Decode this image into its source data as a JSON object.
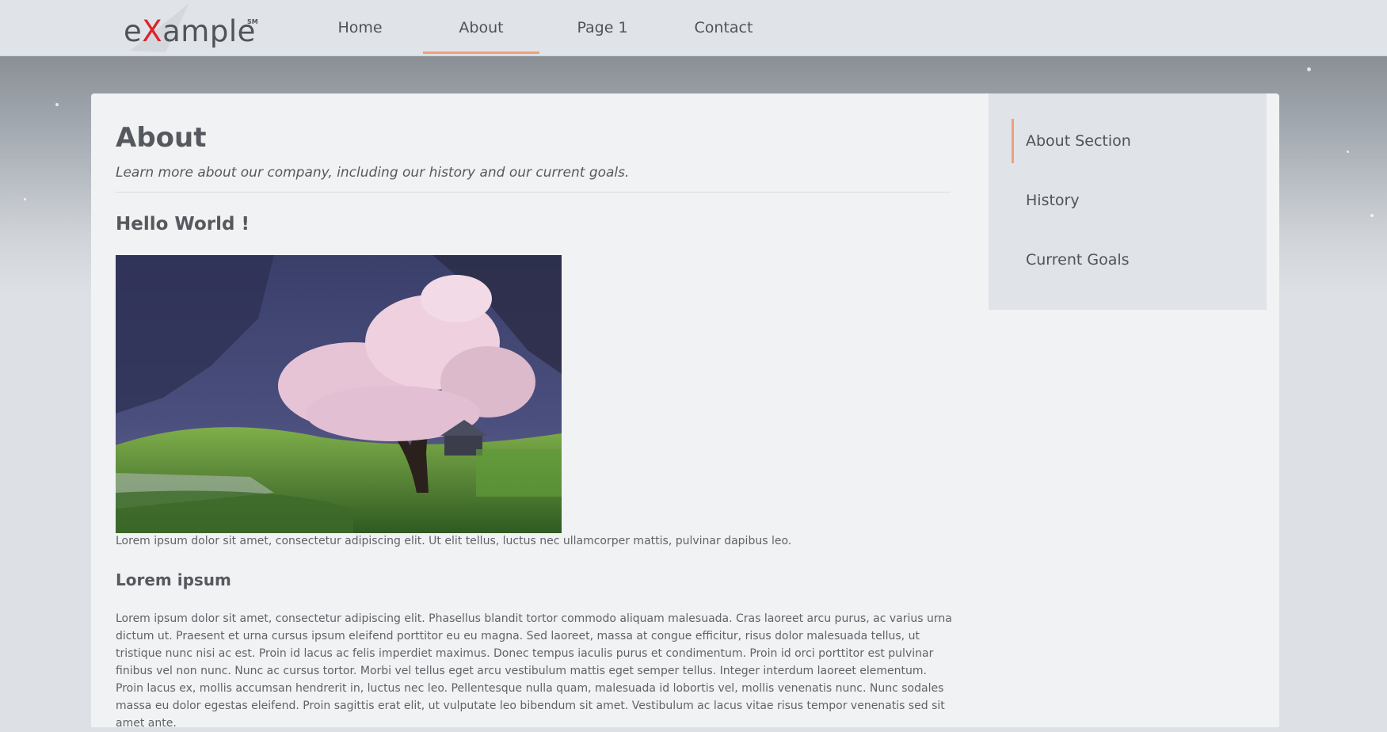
{
  "brand": {
    "logo_prefix": "e",
    "logo_x": "X",
    "logo_suffix": "ample",
    "logo_mark": "SM",
    "accent_color": "#f0a07a",
    "logo_x_color": "#d9252b"
  },
  "nav": {
    "items": [
      {
        "label": "Home"
      },
      {
        "label": "About",
        "active": true
      },
      {
        "label": "Page 1"
      },
      {
        "label": "Contact"
      }
    ]
  },
  "main": {
    "title": "About",
    "subtitle": "Learn more about our company, including our history and our current goals.",
    "section_heading": "Hello World !",
    "image_caption": "Lorem ipsum dolor sit amet, consectetur adipiscing elit. Ut elit tellus, luctus nec ullamcorper mattis, pulvinar dapibus leo.",
    "sub_heading": "Lorem ipsum",
    "paragraph": "Lorem ipsum dolor sit amet, consectetur adipiscing elit. Phasellus blandit tortor commodo aliquam malesuada. Cras laoreet arcu purus, ac varius urna dictum ut. Praesent et urna cursus ipsum eleifend porttitor eu eu magna. Sed laoreet, massa at congue efficitur, risus dolor malesuada tellus, ut tristique nunc nisi ac est. Proin id lacus ac felis imperdiet maximus. Donec tempus iaculis purus et condimentum. Proin id orci porttitor est pulvinar finibus vel non nunc. Nunc ac cursus tortor. Morbi vel tellus eget arcu vestibulum mattis eget semper tellus. Integer interdum laoreet elementum. Proin lacus ex, mollis accumsan hendrerit in, luctus nec leo. Pellentesque nulla quam, malesuada id lobortis vel, mollis venenatis nunc. Nunc sodales massa eu dolor egestas eleifend. Proin sagittis erat elit, ut vulputate leo bibendum sit amet. Vestibulum ac lacus vitae risus tempor venenatis sed sit amet ante."
  },
  "sidebar": {
    "items": [
      {
        "label": "About Section",
        "active": true
      },
      {
        "label": "History"
      },
      {
        "label": "Current Goals"
      }
    ]
  }
}
